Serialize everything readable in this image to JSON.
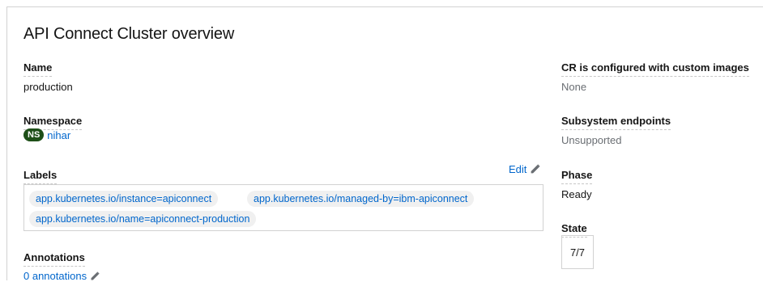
{
  "title": "API Connect Cluster overview",
  "left": {
    "name": {
      "label": "Name",
      "value": "production"
    },
    "namespace": {
      "label": "Namespace",
      "badge": "NS",
      "value": "nihar"
    },
    "labels": {
      "label": "Labels",
      "edit_label": "Edit",
      "chips": [
        "app.kubernetes.io/instance=apiconnect",
        "app.kubernetes.io/managed-by=ibm-apiconnect",
        "app.kubernetes.io/name=apiconnect-production"
      ]
    },
    "annotations": {
      "label": "Annotations",
      "value": "0 annotations"
    }
  },
  "right": {
    "custom_images": {
      "label": "CR is configured with custom images",
      "value": "None"
    },
    "endpoints": {
      "label": "Subsystem endpoints",
      "value": "Unsupported"
    },
    "phase": {
      "label": "Phase",
      "value": "Ready"
    },
    "state": {
      "label": "State",
      "value": "7/7"
    }
  },
  "icons": {
    "edit": "pencil-icon",
    "annotations_edit": "pencil-icon"
  },
  "colors": {
    "link": "#0066cc",
    "ns_badge": "#1e4f18",
    "muted": "#6a6e73"
  }
}
